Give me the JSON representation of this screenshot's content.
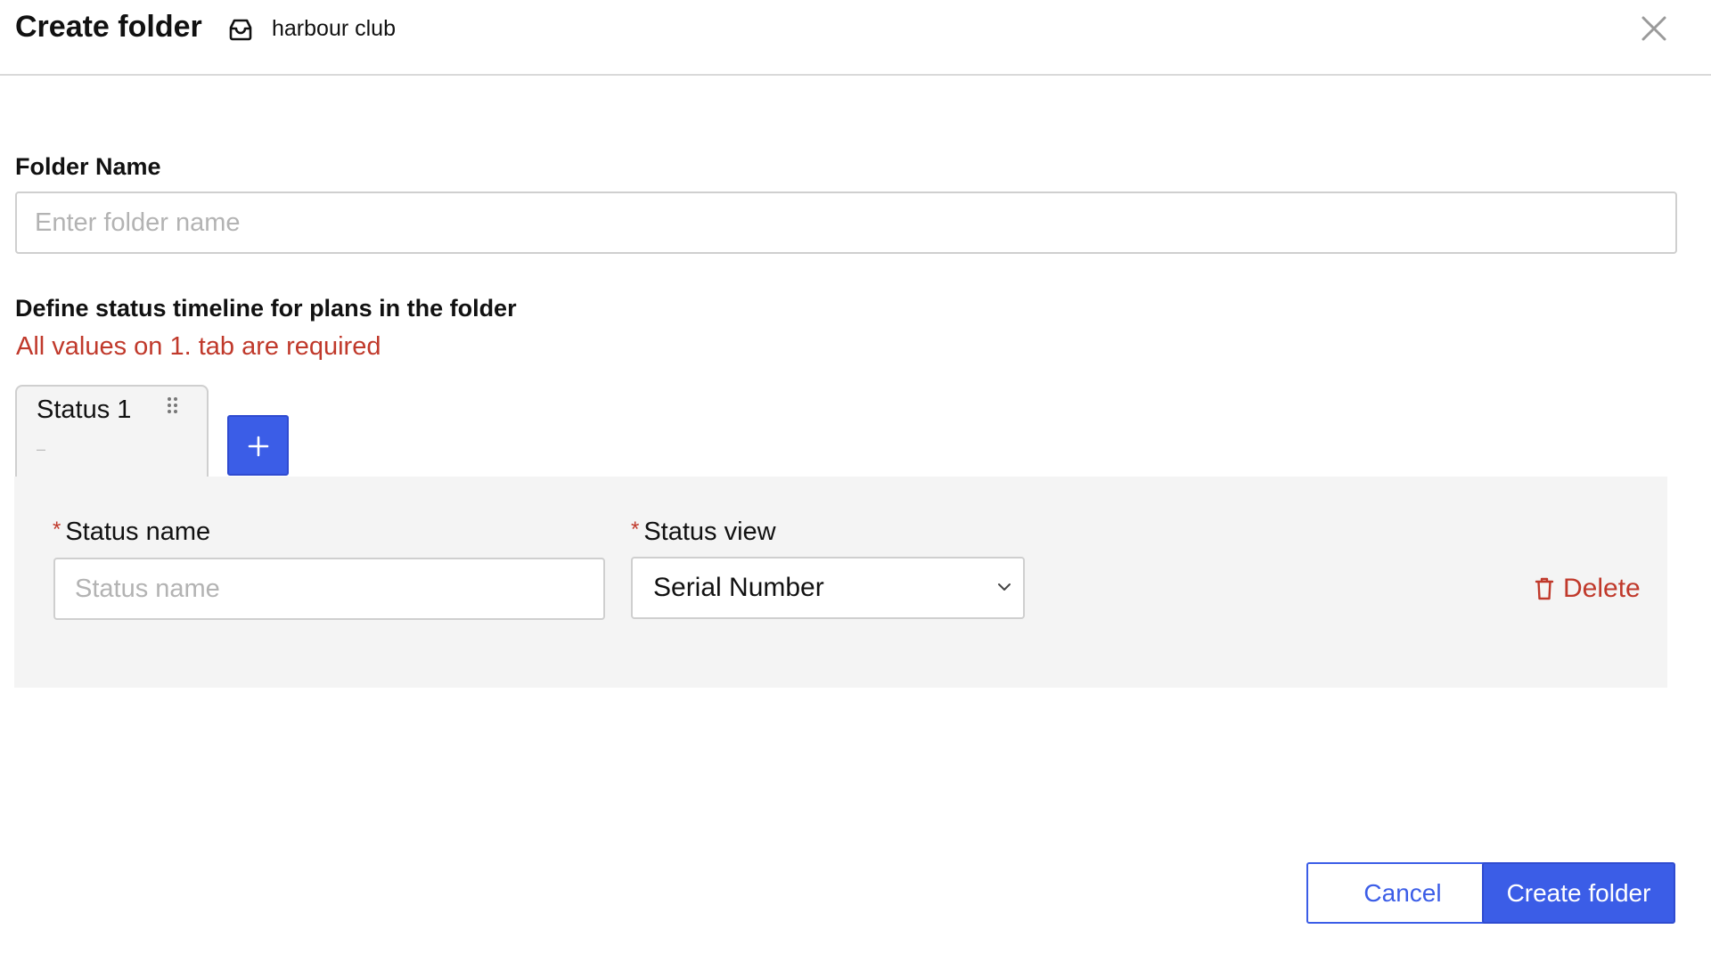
{
  "header": {
    "title": "Create folder",
    "workspace_icon": "inbox-icon",
    "workspace_name": "harbour club",
    "close_icon": "close-icon"
  },
  "folder": {
    "label": "Folder Name",
    "placeholder": "Enter folder name",
    "value": ""
  },
  "timeline": {
    "label": "Define status timeline for plans in the folder",
    "error": "All values on 1. tab are required",
    "tabs": [
      {
        "label": "Status 1",
        "sublabel": "–"
      }
    ],
    "add_icon": "plus-icon",
    "drag_icon": "drag-handle-icon"
  },
  "status_form": {
    "required_mark": "*",
    "name_label": "Status name",
    "name_placeholder": "Status name",
    "name_value": "",
    "view_label": "Status view",
    "view_value": "Serial Number",
    "delete_label": "Delete",
    "delete_icon": "trash-icon"
  },
  "footer": {
    "cancel_label": "Cancel",
    "create_label": "Create folder"
  },
  "colors": {
    "accent": "#3b5de7",
    "error": "#c0392b",
    "panel_bg": "#f4f4f4",
    "border": "#cfcfcf"
  }
}
